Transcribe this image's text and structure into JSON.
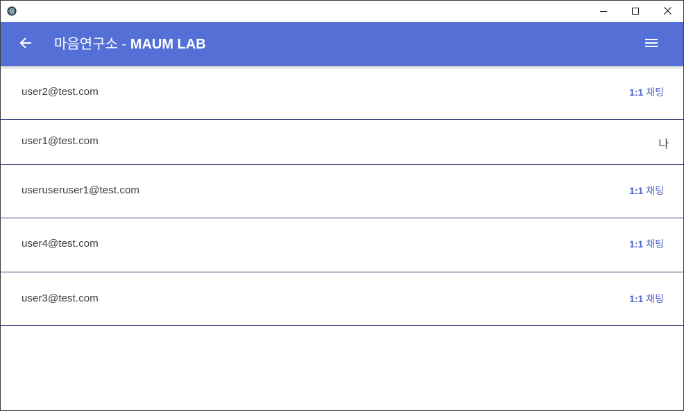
{
  "titlebar": {
    "icon": "electron-atom-icon",
    "controls": [
      "minimize-icon",
      "maximize-icon",
      "close-icon"
    ]
  },
  "appbar": {
    "title_korean": "마음연구소 - ",
    "title_brand": "MAUM LAB",
    "back_icon": "arrow-left-icon",
    "menu_icon": "hamburger-menu-icon",
    "color": "#5470d6"
  },
  "users": [
    {
      "email": "user2@test.com",
      "action_num": "1:1",
      "action_text": " 채팅",
      "is_me": false
    },
    {
      "email": "user1@test.com",
      "me_label": "나",
      "is_me": true
    },
    {
      "email": "useruseruser1@test.com",
      "action_num": "1:1",
      "action_text": " 채팅",
      "is_me": false
    },
    {
      "email": "user4@test.com",
      "action_num": "1:1",
      "action_text": " 채팅",
      "is_me": false
    },
    {
      "email": "user3@test.com",
      "action_num": "1:1",
      "action_text": " 채팅",
      "is_me": false
    }
  ],
  "colors": {
    "accent": "#5470d6",
    "link": "#4a63c9",
    "divider": "#33407a"
  }
}
